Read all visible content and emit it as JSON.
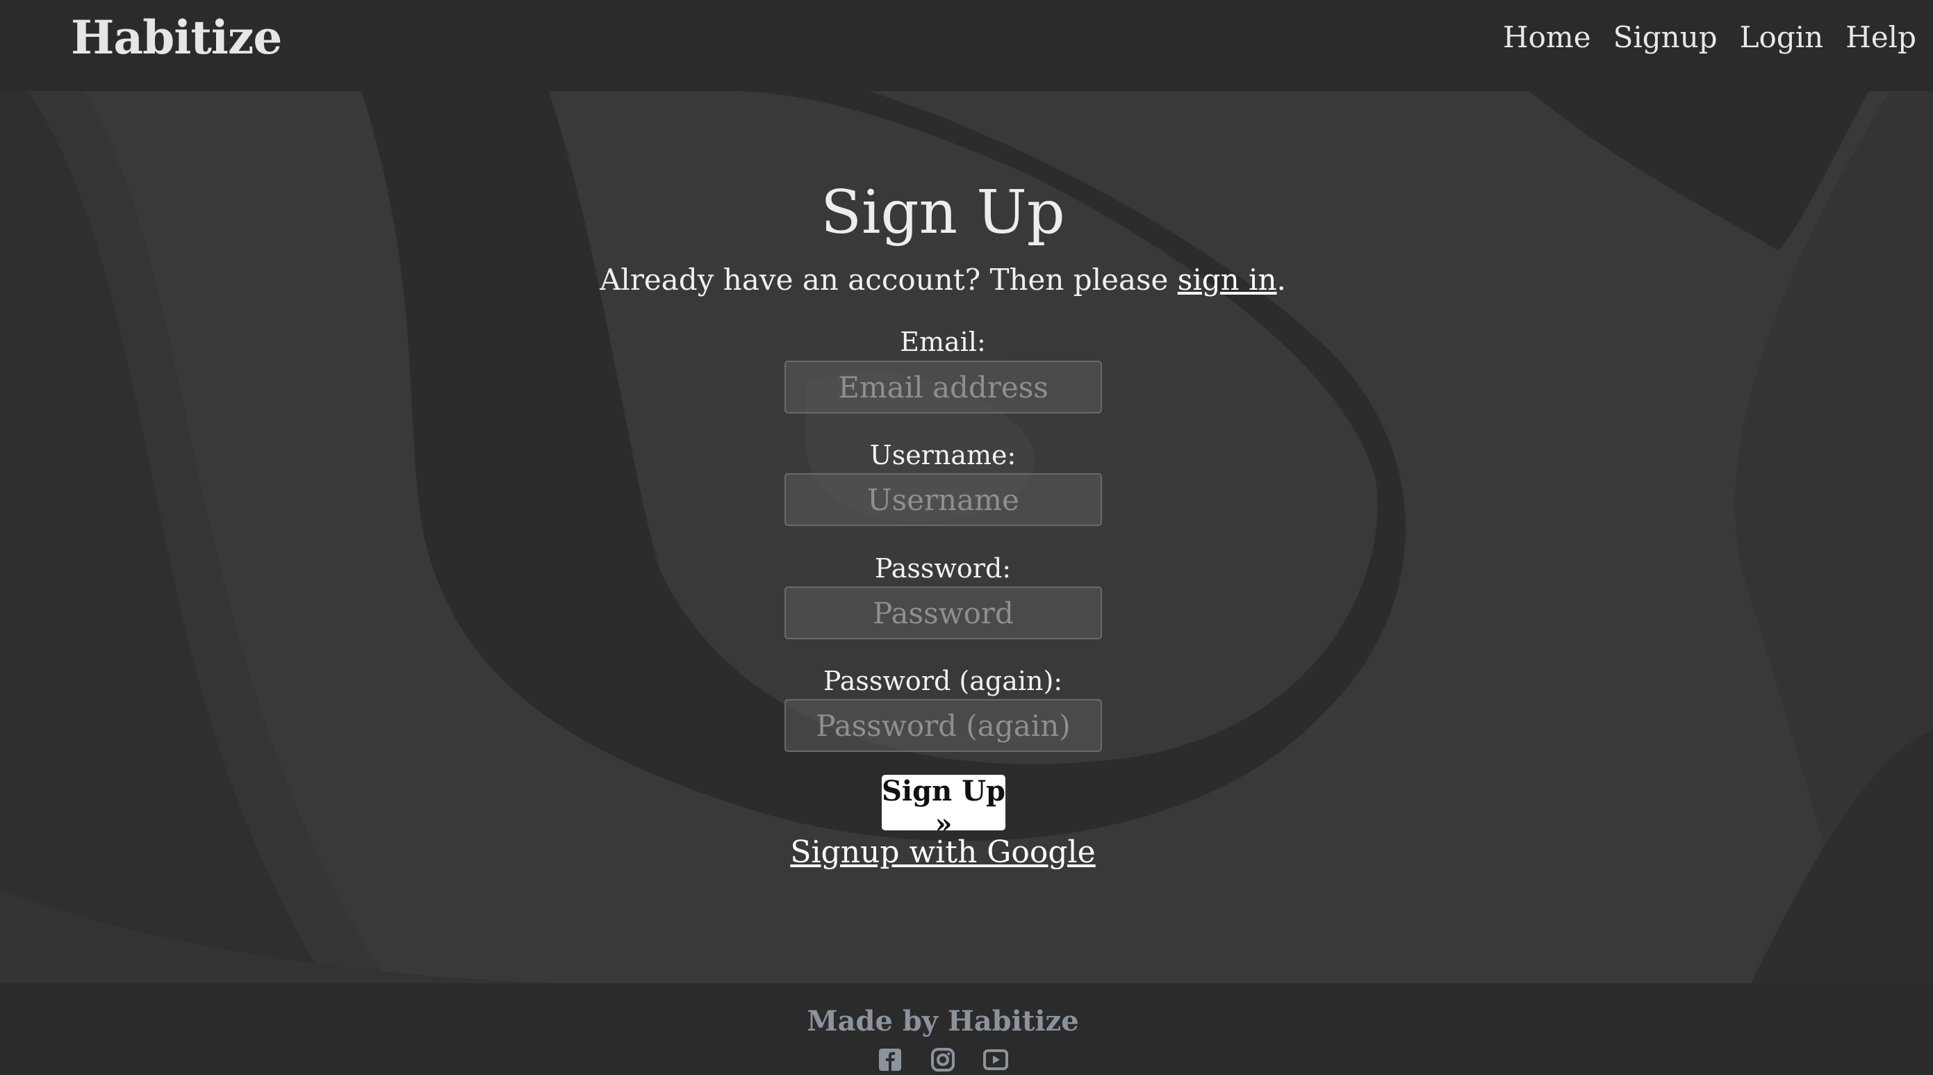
{
  "navbar": {
    "brand": "Habitize",
    "links": [
      "Home",
      "Signup",
      "Login",
      "Help"
    ]
  },
  "signup": {
    "title": "Sign Up",
    "subtitle_prefix": "Already have an account? Then please ",
    "subtitle_link": "sign in",
    "subtitle_suffix": ".",
    "email_label": "Email:",
    "email_placeholder": "Email address",
    "username_label": "Username:",
    "username_placeholder": "Username",
    "password_label": "Password:",
    "password_placeholder": "Password",
    "password2_label": "Password (again):",
    "password2_placeholder": "Password (again)",
    "submit_label": "Sign Up »",
    "google_link": "Signup with Google"
  },
  "footer": {
    "text": "Made by Habitize",
    "socials": [
      "facebook-icon",
      "instagram-icon",
      "youtube-icon"
    ]
  },
  "colors": {
    "background": "#2b2b2b",
    "hero": "#3a3a3a",
    "button": "#ffffff",
    "footer_text": "#8d939b"
  }
}
